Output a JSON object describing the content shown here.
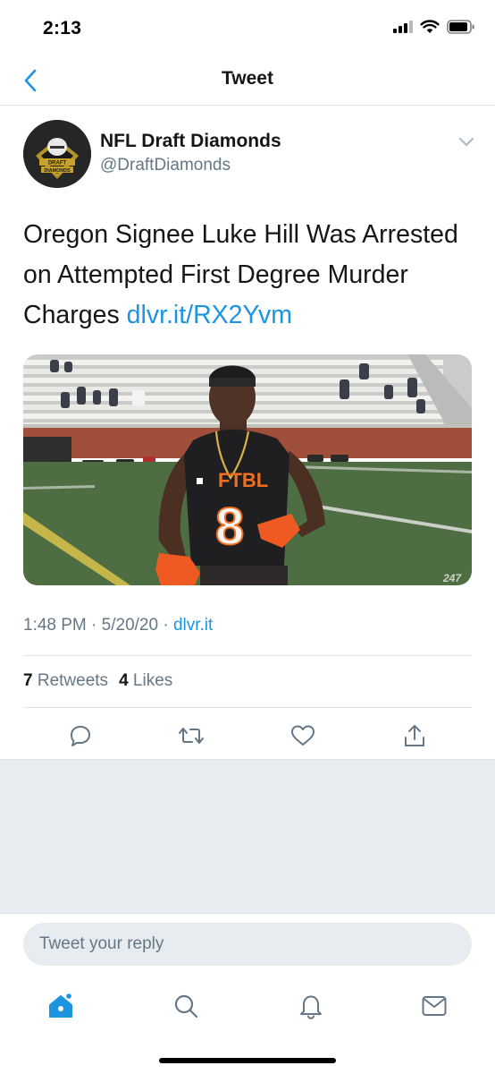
{
  "status_bar": {
    "time": "2:13"
  },
  "nav": {
    "title": "Tweet"
  },
  "tweet": {
    "author_name": "NFL Draft Diamonds",
    "author_handle": "@DraftDiamonds",
    "avatar_text_top": "DRAFT",
    "avatar_text_bottom": "DIAMONDS",
    "text": "Oregon Signee Luke Hill Was Arrested on Attempted First Degree Murder Charges ",
    "link": "dlvr.it/RX2Yvm",
    "photo": {
      "jersey_text": "FTBL",
      "jersey_number": "8",
      "watermark": "247"
    },
    "time": "1:48 PM",
    "date": "5/20/20",
    "meta_sep": "·",
    "source": "dlvr.it",
    "retweets_count": "7",
    "retweets_label": "Retweets",
    "likes_count": "4",
    "likes_label": "Likes"
  },
  "reply": {
    "placeholder": "Tweet your reply"
  },
  "colors": {
    "accent": "#1b95e0",
    "muted": "#657786",
    "text": "#14171a",
    "background_gray": "#e6ecf0"
  },
  "icons": {
    "actions": [
      "reply-icon",
      "retweet-icon",
      "like-icon",
      "share-icon"
    ],
    "tabs": [
      "home-icon",
      "search-icon",
      "notifications-icon",
      "messages-icon"
    ]
  }
}
